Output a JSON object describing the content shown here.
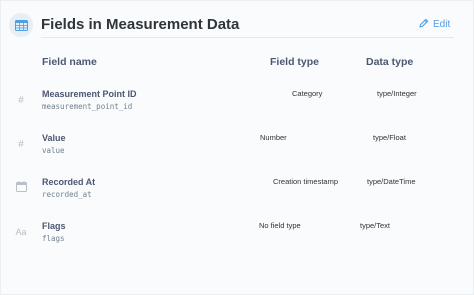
{
  "header": {
    "title": "Fields in Measurement Data",
    "edit_label": "Edit",
    "accent_color": "#509ee3"
  },
  "columns": {
    "field_name": "Field name",
    "field_type": "Field type",
    "data_type": "Data type"
  },
  "rows": [
    {
      "icon": "hash-icon",
      "icon_glyph": "#",
      "name": "Measurement Point ID",
      "column_id": "measurement_point_id",
      "field_type": "Category",
      "data_type": "type/Integer"
    },
    {
      "icon": "hash-icon",
      "icon_glyph": "#",
      "name": "Value",
      "column_id": "value",
      "field_type": "Number",
      "data_type": "type/Float"
    },
    {
      "icon": "calendar-icon",
      "icon_glyph": "",
      "name": "Recorded At",
      "column_id": "recorded_at",
      "field_type": "Creation timestamp",
      "data_type": "type/DateTime"
    },
    {
      "icon": "text-icon",
      "icon_glyph": "Aa",
      "name": "Flags",
      "column_id": "flags",
      "field_type": "No field type",
      "data_type": "type/Text"
    }
  ]
}
